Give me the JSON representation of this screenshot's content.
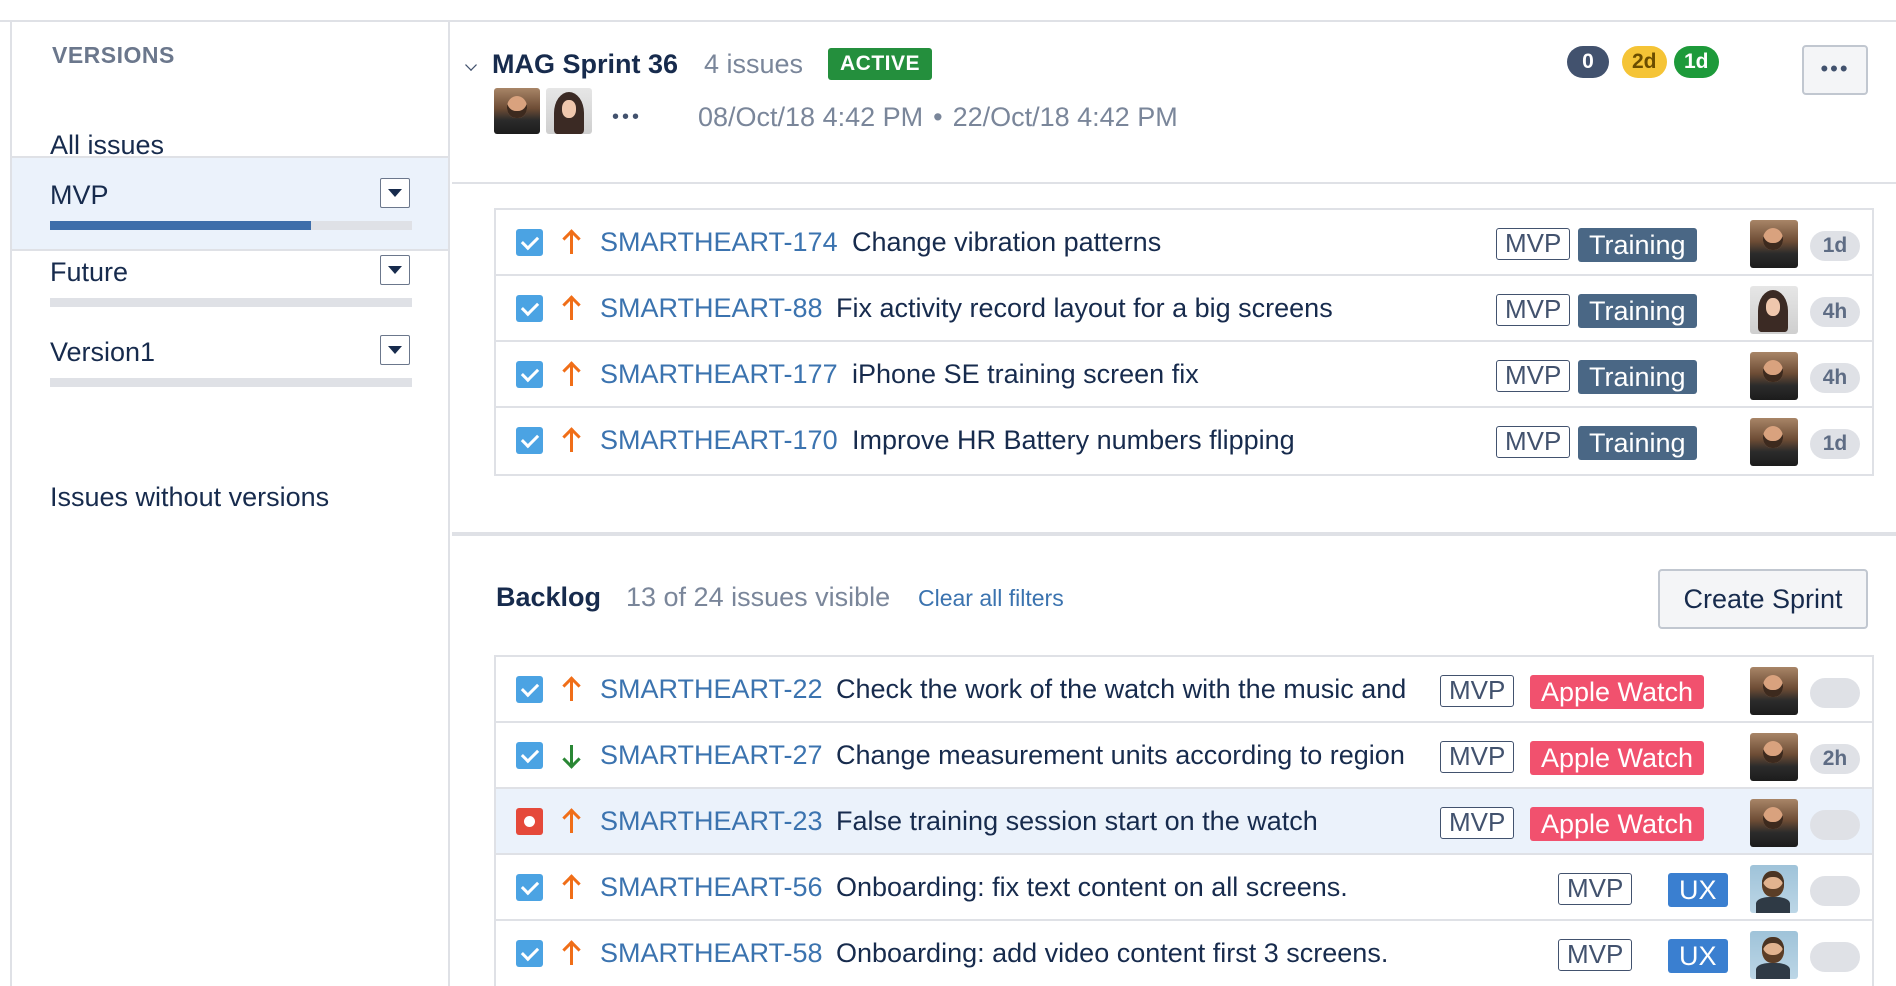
{
  "sidebar": {
    "heading": "VERSIONS",
    "all_issues": "All issues",
    "versions": [
      {
        "label": "MVP",
        "progress": 0.72,
        "selected": true
      },
      {
        "label": "Future",
        "progress": 0,
        "selected": false
      },
      {
        "label": "Version1",
        "progress": 0,
        "selected": false
      }
    ],
    "without_versions": "Issues without versions"
  },
  "sprint": {
    "name": "MAG Sprint 36",
    "count": "4 issues",
    "status": "ACTIVE",
    "todo_estimate": "0",
    "inprogress_estimate": "2d",
    "done_estimate": "1d",
    "start": "08/Oct/18 4:42 PM",
    "separator": "•",
    "end": "22/Oct/18 4:42 PM",
    "more_participants": "•••",
    "issues": [
      {
        "key": "SMARTHEART-174",
        "summary": "Change vibration patterns",
        "type": "task",
        "priority": "high",
        "version": "MVP",
        "epic": "Training",
        "epic_color": "#4a6785",
        "assignee": "male",
        "estimate": "1d"
      },
      {
        "key": "SMARTHEART-88",
        "summary": "Fix activity record layout for a big screens",
        "type": "task",
        "priority": "high",
        "version": "MVP",
        "epic": "Training",
        "epic_color": "#4a6785",
        "assignee": "female",
        "estimate": "4h"
      },
      {
        "key": "SMARTHEART-177",
        "summary": "iPhone SE training screen fix",
        "type": "task",
        "priority": "high",
        "version": "MVP",
        "epic": "Training",
        "epic_color": "#4a6785",
        "assignee": "male",
        "estimate": "4h"
      },
      {
        "key": "SMARTHEART-170",
        "summary": "Improve HR Battery numbers flipping",
        "type": "task",
        "priority": "high",
        "version": "MVP",
        "epic": "Training",
        "epic_color": "#4a6785",
        "assignee": "male",
        "estimate": "1d"
      }
    ]
  },
  "backlog": {
    "title": "Backlog",
    "count": "13 of 24 issues visible",
    "clear_filters": "Clear all filters",
    "create_sprint": "Create Sprint",
    "issues": [
      {
        "key": "SMARTHEART-22",
        "summary": "Check the work of the watch with the music and",
        "type": "task",
        "priority": "high",
        "version": "MVP",
        "epic": "Apple Watch",
        "epic_color": "#f1516e",
        "assignee": "male",
        "estimate": ""
      },
      {
        "key": "SMARTHEART-27",
        "summary": "Change measurement units according to region",
        "type": "task",
        "priority": "low",
        "version": "MVP",
        "epic": "Apple Watch",
        "epic_color": "#f1516e",
        "assignee": "male",
        "estimate": "2h"
      },
      {
        "key": "SMARTHEART-23",
        "summary": "False training session start on the watch",
        "type": "bug",
        "priority": "high",
        "version": "MVP",
        "epic": "Apple Watch",
        "epic_color": "#f1516e",
        "assignee": "male",
        "estimate": "",
        "selected": true
      },
      {
        "key": "SMARTHEART-56",
        "summary": "Onboarding: fix text content on all screens.",
        "type": "task",
        "priority": "high",
        "version": "MVP",
        "epic": "UX",
        "epic_color": "#3a7fd0",
        "assignee": "ux",
        "estimate": ""
      },
      {
        "key": "SMARTHEART-58",
        "summary": "Onboarding: add video content first 3 screens.",
        "type": "task",
        "priority": "high",
        "version": "MVP",
        "epic": "UX",
        "epic_color": "#3a7fd0",
        "assignee": "ux",
        "estimate": ""
      }
    ]
  }
}
